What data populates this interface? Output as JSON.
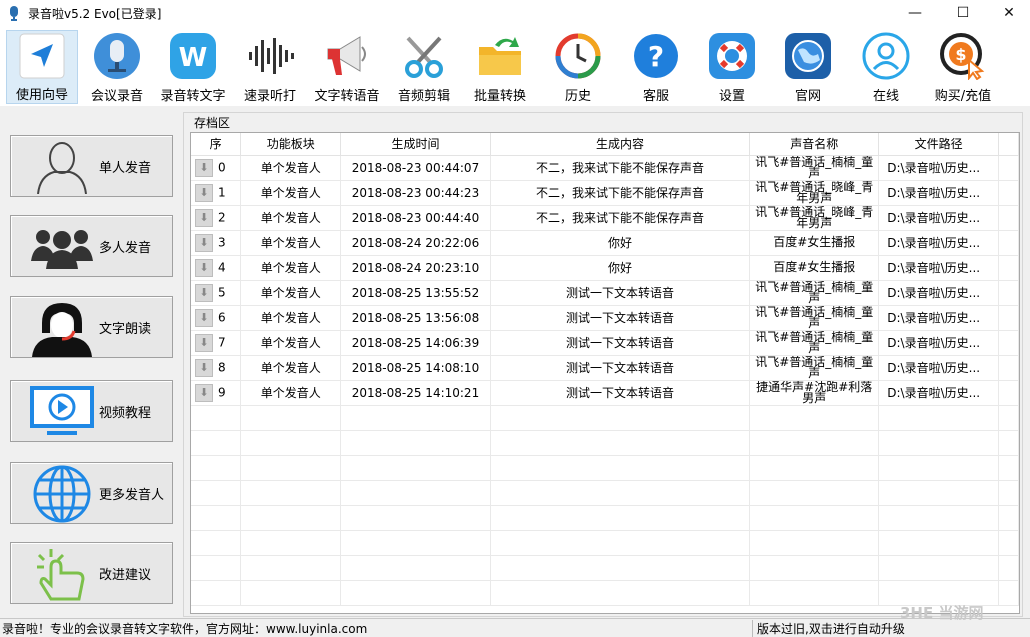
{
  "window": {
    "title": "录音啦v5.2 Evo[已登录]",
    "minimize": "—",
    "maximize": "☐",
    "close": "✕"
  },
  "toolbar": [
    {
      "label": "使用向导",
      "icon": "navigation-arrow-icon"
    },
    {
      "label": "会议录音",
      "icon": "microphone-icon"
    },
    {
      "label": "录音转文字",
      "icon": "w-letter-icon"
    },
    {
      "label": "速录听打",
      "icon": "sound-wave-icon"
    },
    {
      "label": "文字转语音",
      "icon": "megaphone-icon"
    },
    {
      "label": "音频剪辑",
      "icon": "scissors-icon"
    },
    {
      "label": "批量转换",
      "icon": "folder-arrow-icon"
    },
    {
      "label": "历史",
      "icon": "history-clock-icon"
    },
    {
      "label": "客服",
      "icon": "question-icon"
    },
    {
      "label": "设置",
      "icon": "lifebuoy-icon"
    },
    {
      "label": "官网",
      "icon": "globe-icon"
    },
    {
      "label": "在线",
      "icon": "user-circle-icon"
    },
    {
      "label": "购买/充值",
      "icon": "dollar-cursor-icon"
    }
  ],
  "left_buttons": [
    {
      "label": "单人发音",
      "icon": "single-person-icon"
    },
    {
      "label": "多人发音",
      "icon": "group-icon"
    },
    {
      "label": "文字朗读",
      "icon": "headset-operator-icon"
    },
    {
      "label": "视频教程",
      "icon": "video-monitor-icon"
    },
    {
      "label": "更多发音人",
      "icon": "globe-grid-icon"
    },
    {
      "label": "改进建议",
      "icon": "hand-click-icon"
    }
  ],
  "archive": {
    "title": "存档区",
    "columns": [
      "序",
      "功能板块",
      "生成时间",
      "生成内容",
      "声音名称",
      "文件路径"
    ],
    "rows": [
      {
        "seq": "0",
        "module": "单个发音人",
        "time": "2018-08-23 00:44:07",
        "content": "不二，我来试下能不能保存声音",
        "voice": "讯飞#普通话_楠楠_童声",
        "path": "D:\\录音啦\\历史..."
      },
      {
        "seq": "1",
        "module": "单个发音人",
        "time": "2018-08-23 00:44:23",
        "content": "不二，我来试下能不能保存声音",
        "voice": "讯飞#普通话_晓峰_青年男声",
        "path": "D:\\录音啦\\历史..."
      },
      {
        "seq": "2",
        "module": "单个发音人",
        "time": "2018-08-23 00:44:40",
        "content": "不二，我来试下能不能保存声音",
        "voice": "讯飞#普通话_晓峰_青年男声",
        "path": "D:\\录音啦\\历史..."
      },
      {
        "seq": "3",
        "module": "单个发音人",
        "time": "2018-08-24 20:22:06",
        "content": "你好",
        "voice": "百度#女生播报",
        "path": "D:\\录音啦\\历史..."
      },
      {
        "seq": "4",
        "module": "单个发音人",
        "time": "2018-08-24 20:23:10",
        "content": "你好",
        "voice": "百度#女生播报",
        "path": "D:\\录音啦\\历史..."
      },
      {
        "seq": "5",
        "module": "单个发音人",
        "time": "2018-08-25 13:55:52",
        "content": "测试一下文本转语音",
        "voice": "讯飞#普通话_楠楠_童声",
        "path": "D:\\录音啦\\历史..."
      },
      {
        "seq": "6",
        "module": "单个发音人",
        "time": "2018-08-25 13:56:08",
        "content": "测试一下文本转语音",
        "voice": "讯飞#普通话_楠楠_童声",
        "path": "D:\\录音啦\\历史..."
      },
      {
        "seq": "7",
        "module": "单个发音人",
        "time": "2018-08-25 14:06:39",
        "content": "测试一下文本转语音",
        "voice": "讯飞#普通话_楠楠_童声",
        "path": "D:\\录音啦\\历史..."
      },
      {
        "seq": "8",
        "module": "单个发音人",
        "time": "2018-08-25 14:08:10",
        "content": "测试一下文本转语音",
        "voice": "讯飞#普通话_楠楠_童声",
        "path": "D:\\录音啦\\历史..."
      },
      {
        "seq": "9",
        "module": "单个发音人",
        "time": "2018-08-25 14:10:21",
        "content": "测试一下文本转语音",
        "voice": "捷通华声#沈跑#利落男声",
        "path": "D:\\录音啦\\历史..."
      }
    ]
  },
  "status": {
    "left": "录音啦！专业的会议录音转文字软件，官方网址：www.luyinla.com",
    "right": "版本过旧,双击进行自动升级"
  },
  "watermark": "3HE 当游网"
}
